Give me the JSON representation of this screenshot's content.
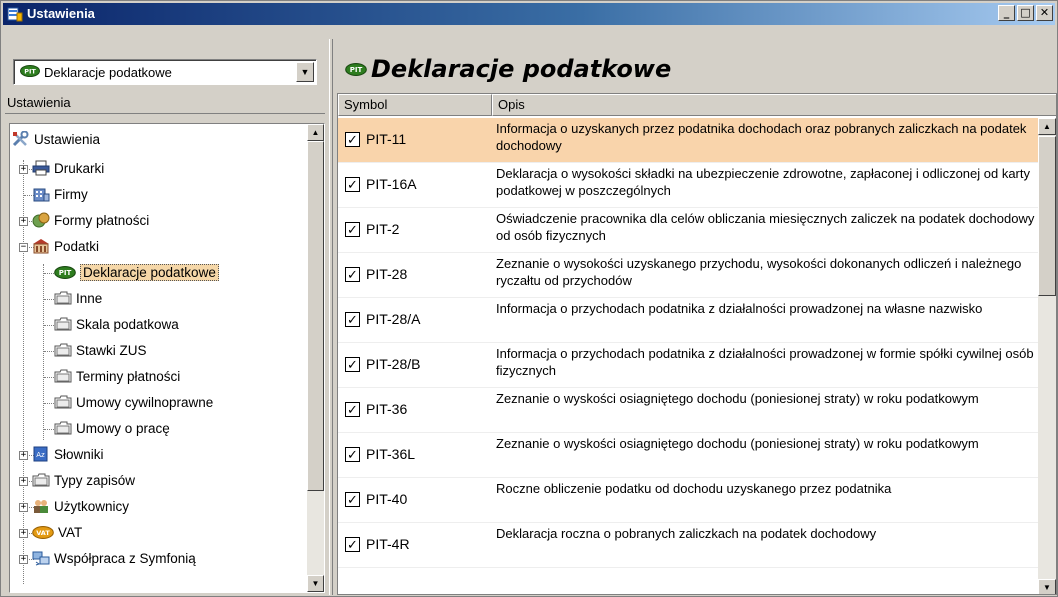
{
  "window": {
    "title": "Ustawienia",
    "controls": [
      "_",
      "□",
      "✕"
    ]
  },
  "left": {
    "combo_value": "Deklaracje podatkowe",
    "section_label": "Ustawienia",
    "tree": [
      {
        "label": "Ustawienia",
        "icon": "tools-icon",
        "level": 0,
        "expander": ""
      },
      {
        "label": "Drukarki",
        "icon": "printer-icon",
        "level": 1,
        "expander": "+"
      },
      {
        "label": "Firmy",
        "icon": "company-icon",
        "level": 1,
        "expander": ""
      },
      {
        "label": "Formy płatności",
        "icon": "payment-icon",
        "level": 1,
        "expander": "+"
      },
      {
        "label": "Podatki",
        "icon": "building-icon",
        "level": 1,
        "expander": "−"
      },
      {
        "label": "Deklaracje podatkowe",
        "icon": "pit-icon",
        "level": 2,
        "expander": "",
        "selected": true
      },
      {
        "label": "Inne",
        "icon": "folder-icon",
        "level": 2,
        "expander": ""
      },
      {
        "label": "Skala podatkowa",
        "icon": "folder-icon",
        "level": 2,
        "expander": ""
      },
      {
        "label": "Stawki ZUS",
        "icon": "folder-icon",
        "level": 2,
        "expander": ""
      },
      {
        "label": "Terminy płatności",
        "icon": "folder-icon",
        "level": 2,
        "expander": ""
      },
      {
        "label": "Umowy cywilnoprawne",
        "icon": "folder-icon",
        "level": 2,
        "expander": ""
      },
      {
        "label": "Umowy o pracę",
        "icon": "folder-icon",
        "level": 2,
        "expander": ""
      },
      {
        "label": "Słowniki",
        "icon": "dictionary-icon",
        "level": 1,
        "expander": "+"
      },
      {
        "label": "Typy zapisów",
        "icon": "folder-icon",
        "level": 1,
        "expander": "+"
      },
      {
        "label": "Użytkownicy",
        "icon": "users-icon",
        "level": 1,
        "expander": "+"
      },
      {
        "label": "VAT",
        "icon": "vat-icon",
        "level": 1,
        "expander": "+"
      },
      {
        "label": "Współpraca z Symfonią",
        "icon": "sync-icon",
        "level": 1,
        "expander": "+"
      }
    ]
  },
  "right": {
    "title": "Deklaracje podatkowe",
    "columns": {
      "symbol": "Symbol",
      "desc": "Opis"
    },
    "rows": [
      {
        "symbol": "PIT-11",
        "checked": true,
        "desc": "Informacja o uzyskanych przez podatnika dochodach oraz pobranych zaliczkach na podatek dochodowy",
        "selected": true
      },
      {
        "symbol": "PIT-16A",
        "checked": true,
        "desc": "Deklaracja o wysokości składki na ubezpieczenie zdrowotne, zapłaconej i odliczonej od karty podatkowej w poszczególnych"
      },
      {
        "symbol": "PIT-2",
        "checked": true,
        "desc": "Oświadczenie pracownika dla celów obliczania miesięcznych zaliczek na podatek dochodowy od osób fizycznych"
      },
      {
        "symbol": "PIT-28",
        "checked": true,
        "desc": "Zeznanie o wysokości uzyskanego przychodu, wysokości dokonanych odliczeń i należnego ryczałtu od przychodów"
      },
      {
        "symbol": "PIT-28/A",
        "checked": true,
        "desc": "Informacja o przychodach podatnika z działalności prowadzonej na własne nazwisko"
      },
      {
        "symbol": "PIT-28/B",
        "checked": true,
        "desc": "Informacja o przychodach podatnika z działalności prowadzonej w formie spółki cywilnej osób fizycznych"
      },
      {
        "symbol": "PIT-36",
        "checked": true,
        "desc": "Zeznanie o wyskości osiagniętego dochodu (poniesionej straty) w roku podatkowym"
      },
      {
        "symbol": "PIT-36L",
        "checked": true,
        "desc": "Zeznanie o wyskości osiagniętego dochodu (poniesionej straty) w roku podatkowym"
      },
      {
        "symbol": "PIT-40",
        "checked": true,
        "desc": "Roczne obliczenie podatku od dochodu uzyskanego przez podatnika"
      },
      {
        "symbol": "PIT-4R",
        "checked": true,
        "desc": "Deklaracja roczna o pobranych zaliczkach na podatek dochodowy"
      }
    ]
  },
  "colors": {
    "selected_row": "#f9d4ab",
    "title_bar": "#0a246a"
  }
}
